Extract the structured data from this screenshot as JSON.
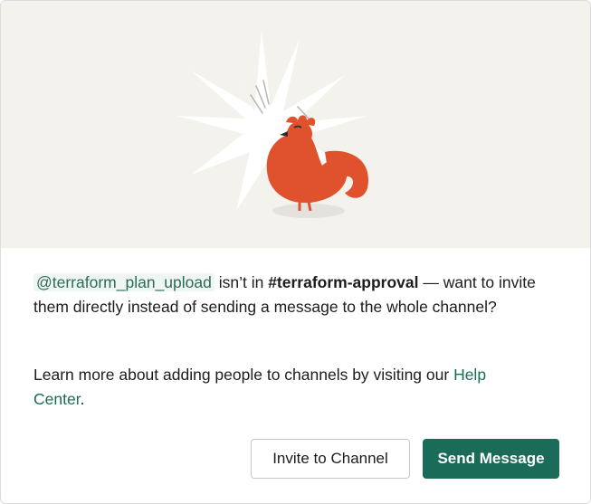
{
  "dialog": {
    "close_icon": "close-icon",
    "illustration_icon": "rooster-illustration-icon"
  },
  "message": {
    "mention": "@terraform_plan_upload",
    "text_before_channel": " isn’t in ",
    "channel": "#terraform-approval",
    "text_after_channel": " — want to invite them directly instead of sending a message to the whole channel?",
    "learn_more_text": "Learn more about adding people to channels by visiting our ",
    "help_link": "Help Center",
    "learn_more_end": "."
  },
  "actions": {
    "invite_label": "Invite to Channel",
    "send_label": "Send Message"
  },
  "colors": {
    "primary": "#1a6b58",
    "hero_bg": "#f4f2ec",
    "rooster": "#e0522e"
  }
}
